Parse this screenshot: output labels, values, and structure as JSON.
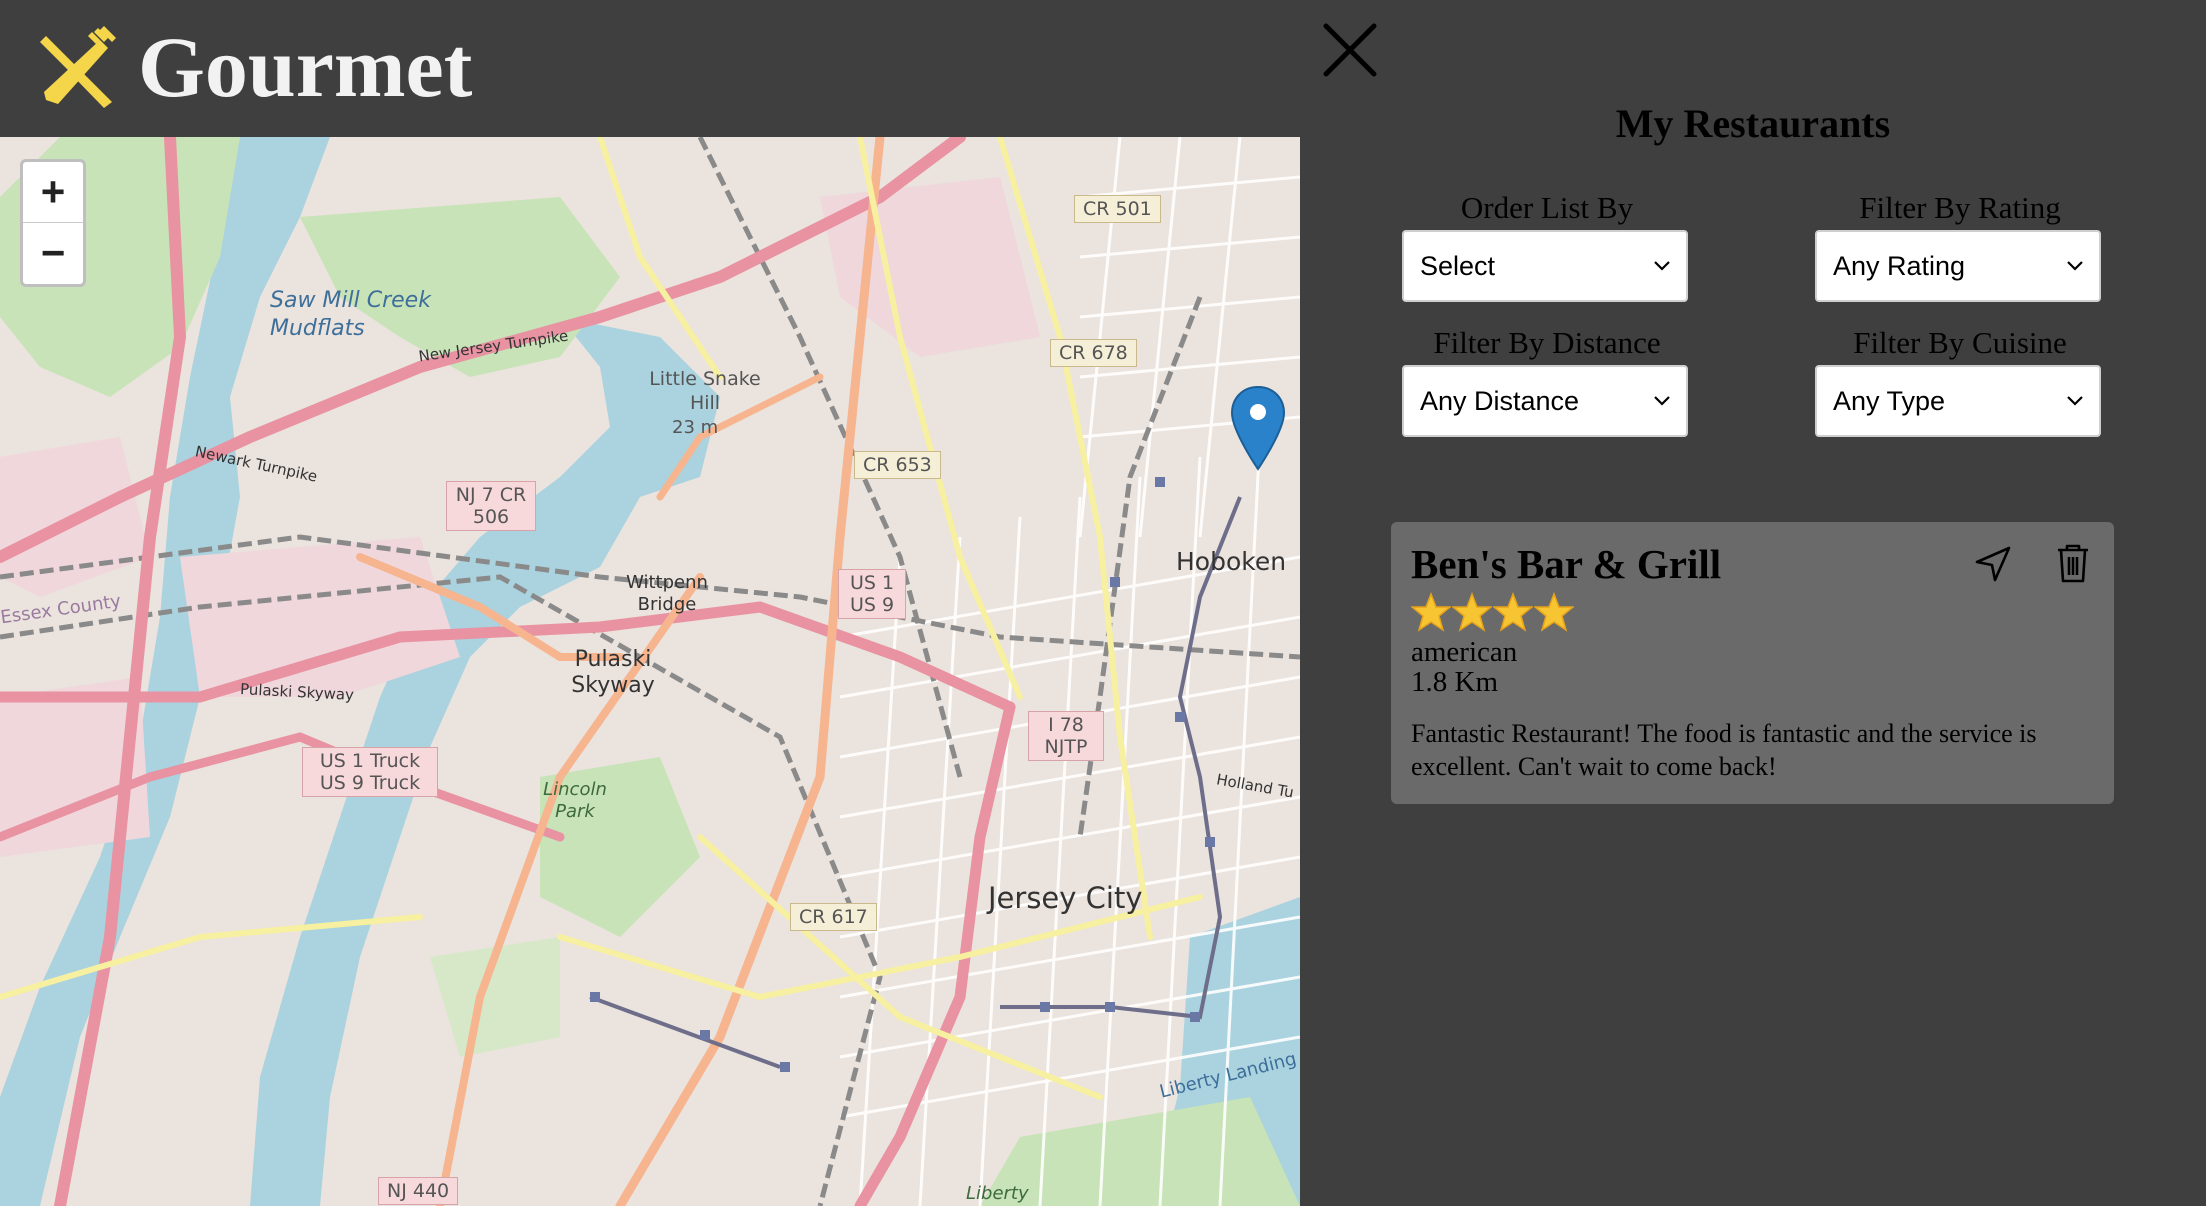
{
  "app": {
    "title": "Gourmet",
    "logo_icon": "fork-knife-icon",
    "logo_color": "#f5d64a"
  },
  "map": {
    "zoom_in": "+",
    "zoom_out": "−",
    "place_labels": [
      "Saw Mill Creek Mudflats",
      "Little Snake Hill",
      "23 m",
      "Hoboken",
      "Jersey City",
      "Pulaski Skyway",
      "Wittpenn Bridge",
      "Lincoln Park",
      "Essex County",
      "Liberty Landing",
      "Liberty"
    ],
    "road_shields": [
      "CR 501",
      "CR 678",
      "CR 653",
      "NJ 7 CR 506",
      "US 1 US 9",
      "I 78 NJTP",
      "US 1 Truck US 9 Truck",
      "CR 617",
      "NJ 440"
    ],
    "road_names": [
      "New Jersey Turnpike",
      "Newark Turnpike",
      "Pulaski Skyway",
      "Holland Tu"
    ],
    "marker_icon": "map-pin-icon",
    "marker_color": "#2a82cb"
  },
  "panel": {
    "close_icon": "close-icon",
    "title": "My Restaurants",
    "filters": {
      "order": {
        "label": "Order List By",
        "value": "Select"
      },
      "rating": {
        "label": "Filter By Rating",
        "value": "Any Rating"
      },
      "distance": {
        "label": "Filter By Distance",
        "value": "Any Distance"
      },
      "cuisine": {
        "label": "Filter By Cuisine",
        "value": "Any Type"
      }
    }
  },
  "restaurants": [
    {
      "name": "Ben's Bar & Grill",
      "rating": 4,
      "cuisine": "american",
      "distance": "1.8 Km",
      "review": "Fantastic Restaurant! The food is fantastic and the service is excellent. Can't wait to come back!",
      "nav_icon": "navigation-arrow-icon",
      "delete_icon": "trash-icon"
    }
  ],
  "colors": {
    "card_bg": "#6a6a6a",
    "page_bg": "#3f3f3f",
    "star": "#f7c531"
  }
}
